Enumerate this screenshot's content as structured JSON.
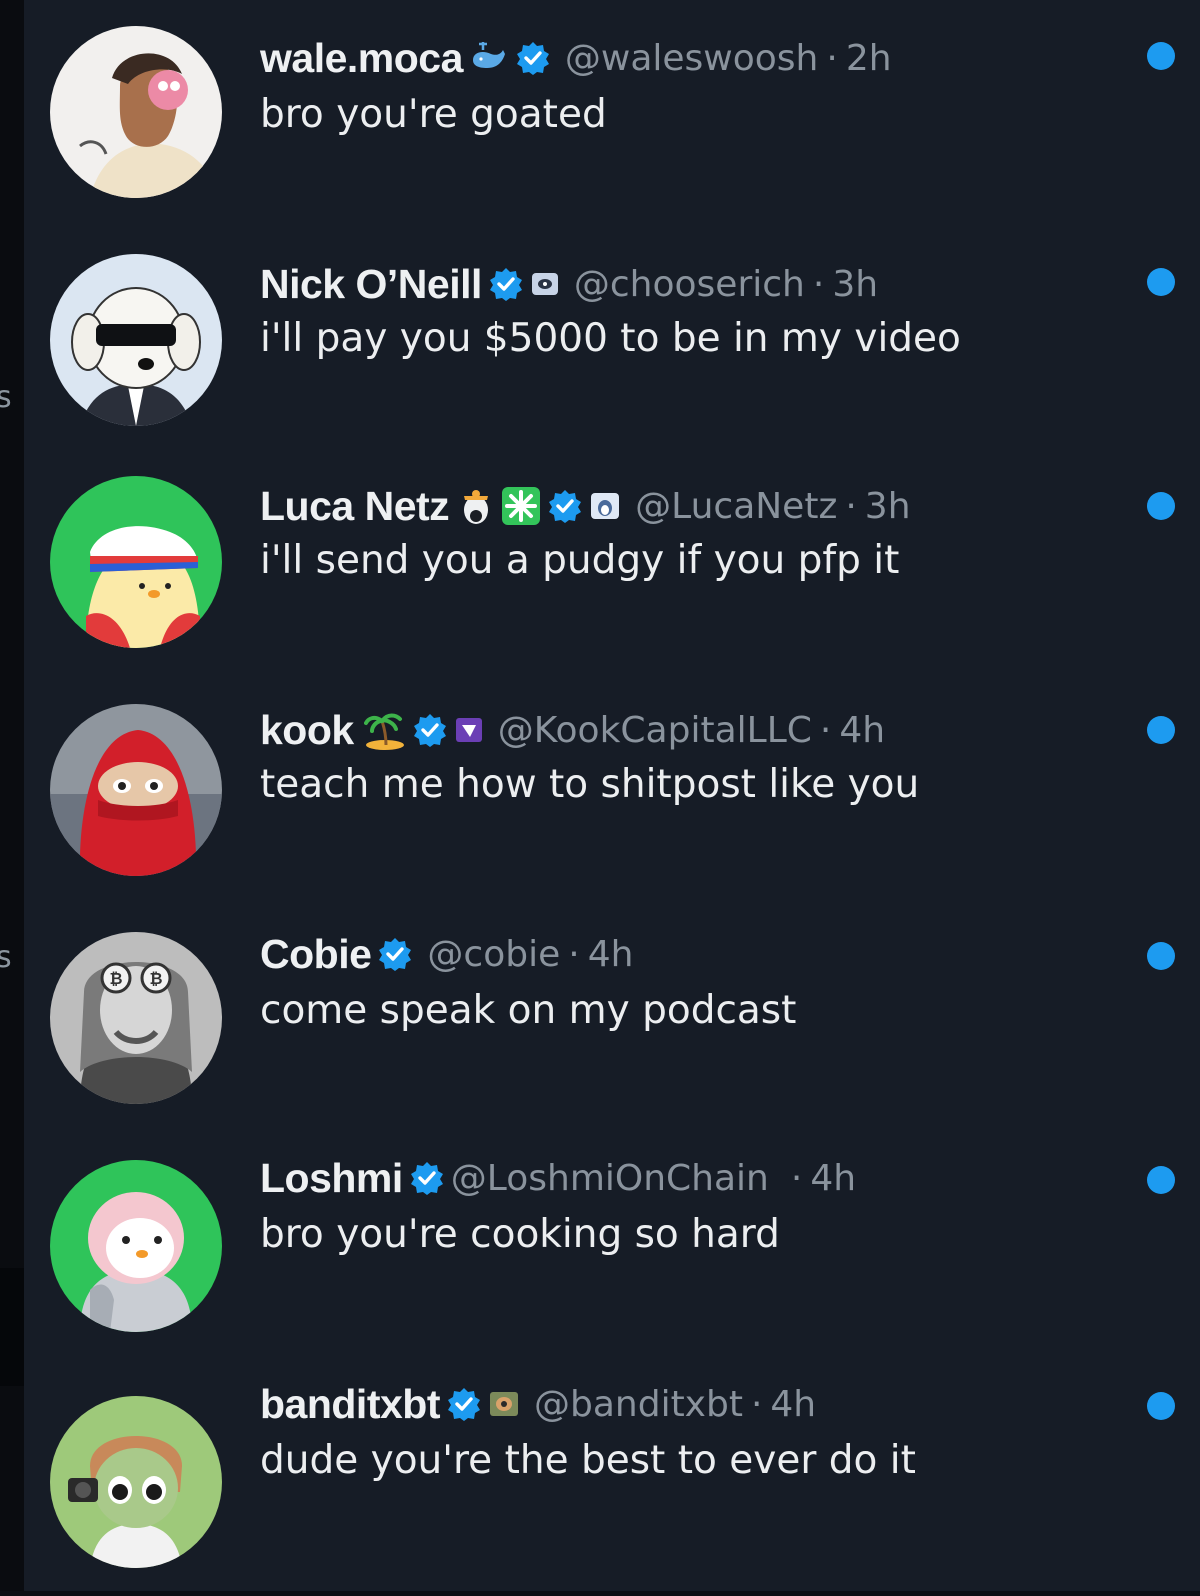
{
  "colors": {
    "background": "#161c26",
    "verified_badge": "#1d9bf0",
    "unread_dot": "#1d9bf0",
    "handle_text": "#8a939d",
    "message_text": "#eceef0"
  },
  "left_edge_glyphs": [
    "s",
    "s"
  ],
  "messages": [
    {
      "display_name": "wale.moca",
      "badges": [
        "whale-emoji-icon",
        "verified-badge-icon"
      ],
      "handle": "@waleswoosh",
      "separator": "·",
      "time": "2h",
      "text": "bro you're goated",
      "unread": true,
      "avatar": "avatar-illustration-man-pink-mask"
    },
    {
      "display_name": "Nick O’Neill",
      "badges": [
        "verified-badge-icon",
        "affiliate-badge-icon"
      ],
      "handle": "@chooserich",
      "separator": "·",
      "time": "3h",
      "text": "i'll pay you $5000 to be in my video",
      "unread": true,
      "avatar": "avatar-dog-in-suit-sunglasses"
    },
    {
      "display_name": "Luca Netz",
      "badges": [
        "penguin-emoji-icon",
        "sparkle-emoji-icon",
        "verified-badge-icon",
        "affiliate-badge-icon"
      ],
      "handle": "@LucaNetz",
      "separator": "·",
      "time": "3h",
      "text": "i'll send you a pudgy if you pfp it",
      "unread": true,
      "avatar": "avatar-pudgy-penguin-headband"
    },
    {
      "display_name": "kook",
      "badges": [
        "island-emoji-icon",
        "verified-badge-icon",
        "affiliate-badge-icon"
      ],
      "handle": "@KookCapitalLLC",
      "separator": "·",
      "time": "4h",
      "text": "teach me how to shitpost like you",
      "unread": true,
      "avatar": "avatar-red-hood-character"
    },
    {
      "display_name": "Cobie",
      "badges": [
        "verified-badge-icon"
      ],
      "handle": "@cobie",
      "separator": "·",
      "time": "4h",
      "text": "come speak on my podcast",
      "unread": true,
      "avatar": "avatar-grayscale-bitcoin-glasses"
    },
    {
      "display_name": "Loshmi",
      "badges": [
        "verified-badge-icon"
      ],
      "handle": "@LoshmiOnChain",
      "separator": "·",
      "time": "4h",
      "text": "bro you're cooking so hard",
      "unread": true,
      "avatar": "avatar-pink-penguin-jacket"
    },
    {
      "display_name": "banditxbt",
      "badges": [
        "verified-badge-icon",
        "affiliate-badge-icon"
      ],
      "handle": "@banditxbt",
      "separator": "·",
      "time": "4h",
      "text": "dude you're the best to ever do it",
      "unread": true,
      "avatar": "avatar-anime-character-camera"
    }
  ]
}
